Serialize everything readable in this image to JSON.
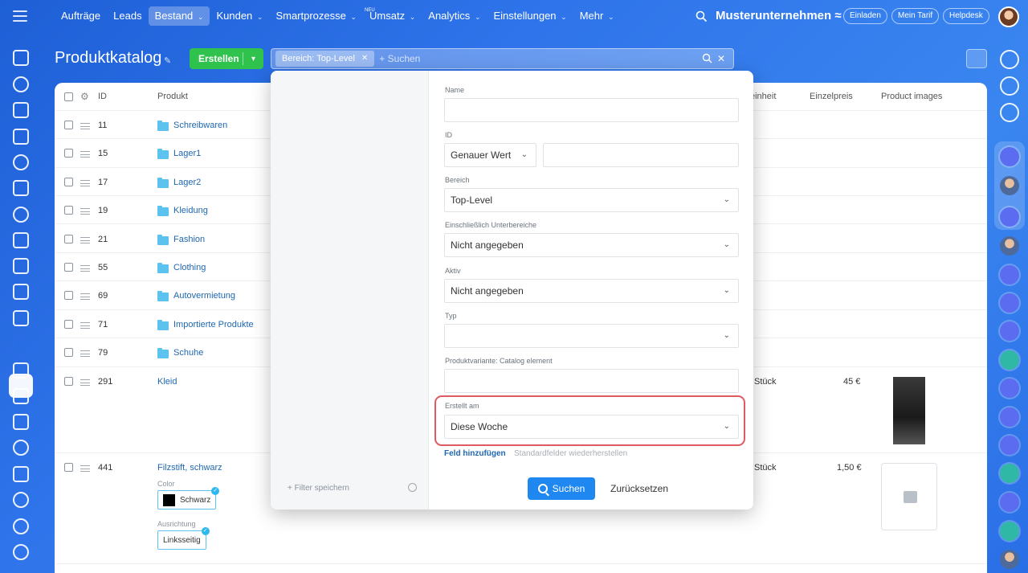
{
  "topnav": {
    "items": [
      {
        "label": "Aufträge"
      },
      {
        "label": "Leads"
      },
      {
        "label": "Bestand",
        "chev": "⌄"
      },
      {
        "label": "Kunden",
        "chev": "⌄"
      },
      {
        "label": "Smartprozesse",
        "chev": "⌄"
      },
      {
        "label": "Umsatz",
        "chev": "⌄",
        "badge": "NEU"
      },
      {
        "label": "Analytics",
        "chev": "⌄"
      },
      {
        "label": "Einstellungen",
        "chev": "⌄"
      },
      {
        "label": "Mehr",
        "chev": "⌄"
      }
    ],
    "company": "Musterunternehmen ≈",
    "invite": "Einladen",
    "plan": "Mein Tarif",
    "helpdesk": "Helpdesk"
  },
  "page": {
    "title": "Produktkatalog",
    "create_label": "Erstellen",
    "filter_chip": "Bereich: Top-Level",
    "search_placeholder": "+ Suchen"
  },
  "grid": {
    "headers": {
      "id": "ID",
      "product": "Produkt",
      "unit": "einheit",
      "price": "Einzelpreis",
      "images": "Product images"
    },
    "rows": [
      {
        "id": "11",
        "name": "Schreibwaren"
      },
      {
        "id": "15",
        "name": "Lager1"
      },
      {
        "id": "17",
        "name": "Lager2"
      },
      {
        "id": "19",
        "name": "Kleidung"
      },
      {
        "id": "21",
        "name": "Fashion"
      },
      {
        "id": "55",
        "name": "Clothing"
      },
      {
        "id": "69",
        "name": "Autovermietung"
      },
      {
        "id": "71",
        "name": "Importierte Produkte"
      },
      {
        "id": "79",
        "name": "Schuhe"
      },
      {
        "id": "291",
        "name": "Kleid",
        "unit": "Stück",
        "price": "45 €"
      },
      {
        "id": "441",
        "name": "Filzstift, schwarz",
        "unit": "Stück",
        "price": "1,50 €"
      }
    ],
    "props": {
      "color_label": "Color",
      "color_value": "Schwarz",
      "align_label": "Ausrichtung",
      "align_value": "Linksseitig"
    }
  },
  "filter": {
    "save_filter": "+ Filter speichern",
    "fields": {
      "name_label": "Name",
      "id_label": "ID",
      "id_mode": "Genauer Wert",
      "area_label": "Bereich",
      "area_value": "Top-Level",
      "sub_label": "Einschließlich Unterbereiche",
      "sub_value": "Nicht angegeben",
      "active_label": "Aktiv",
      "active_value": "Nicht angegeben",
      "type_label": "Typ",
      "variant_label": "Produktvariante: Catalog element",
      "created_label": "Erstellt am",
      "created_value": "Diese Woche"
    },
    "add_field": "Feld hinzufügen",
    "restore_fields": "Standardfelder wiederherstellen",
    "search_btn": "Suchen",
    "reset_btn": "Zurücksetzen"
  }
}
